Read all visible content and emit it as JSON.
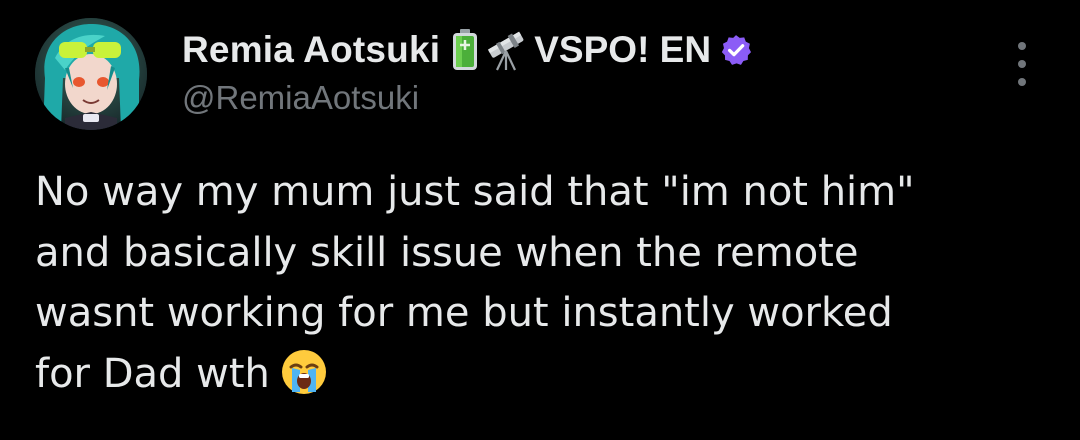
{
  "author": {
    "display_name": "Remia Aotsuki",
    "status_emojis": [
      "battery-icon",
      "telescope-icon"
    ],
    "org_name": "VSPO! EN",
    "verified_badge": "verified-badge-icon",
    "badge_color": "#8b5cf6",
    "handle": "@RemiaAotsuki"
  },
  "tweet": {
    "lines": [
      "No way my mum just said that \"im not him\"",
      "and basically skill issue when the remote",
      "wasnt working for me but instantly worked",
      "for Dad wth"
    ],
    "trailing_emoji": "loudly-crying-face-icon"
  },
  "menu": {
    "icon": "more-options-icon"
  },
  "colors": {
    "background": "#000000",
    "primary_text": "#e7e9ea",
    "secondary_text": "#71767b"
  }
}
